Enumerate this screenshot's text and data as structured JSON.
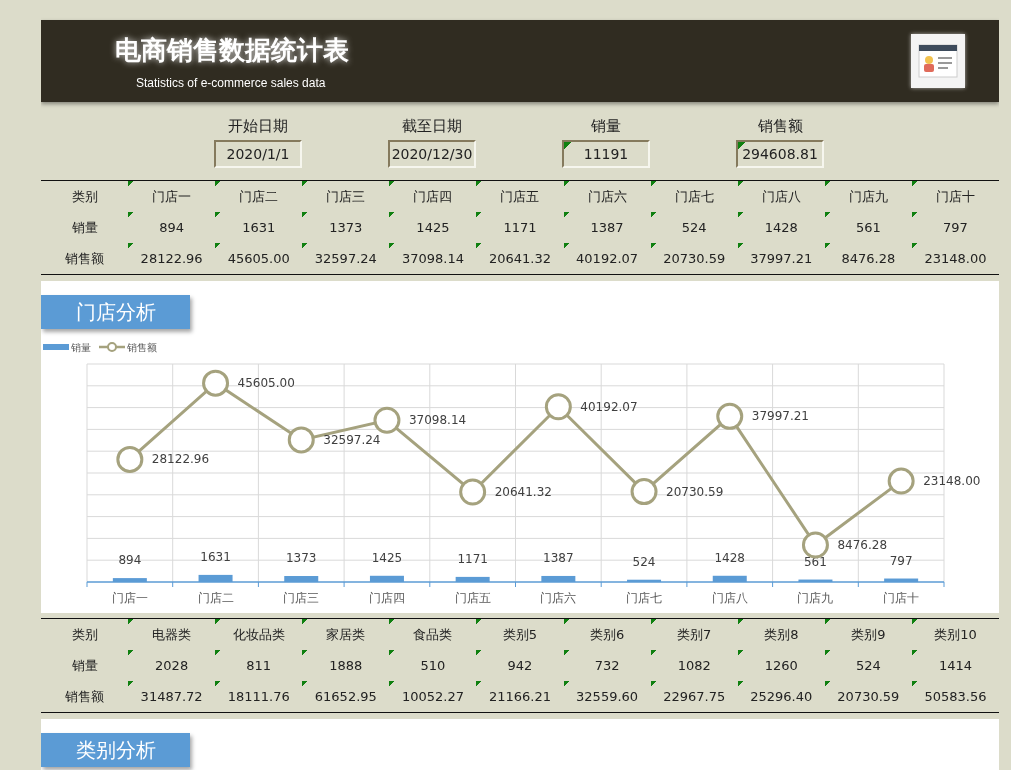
{
  "header": {
    "title": "电商销售数据统计表",
    "subtitle": "Statistics of e-commerce sales data"
  },
  "summary": [
    {
      "label": "开始日期",
      "value": "2020/1/1",
      "error_mark": false
    },
    {
      "label": "截至日期",
      "value": "2020/12/30",
      "error_mark": false
    },
    {
      "label": "销量",
      "value": "11191",
      "error_mark": true
    },
    {
      "label": "销售额",
      "value": "294608.81",
      "error_mark": true
    }
  ],
  "store_table": {
    "rows": [
      {
        "header": "类别",
        "cells": [
          "门店一",
          "门店二",
          "门店三",
          "门店四",
          "门店五",
          "门店六",
          "门店七",
          "门店八",
          "门店九",
          "门店十"
        ]
      },
      {
        "header": "销量",
        "cells": [
          "894",
          "1631",
          "1373",
          "1425",
          "1171",
          "1387",
          "524",
          "1428",
          "561",
          "797"
        ]
      },
      {
        "header": "销售额",
        "cells": [
          "28122.96",
          "45605.00",
          "32597.24",
          "37098.14",
          "20641.32",
          "40192.07",
          "20730.59",
          "37997.21",
          "8476.28",
          "23148.00"
        ]
      }
    ]
  },
  "store_section": {
    "title": "门店分析",
    "chart_data": {
      "type": "bar",
      "categories": [
        "门店一",
        "门店二",
        "门店三",
        "门店四",
        "门店五",
        "门店六",
        "门店七",
        "门店八",
        "门店九",
        "门店十"
      ],
      "ylim": [
        0,
        50000
      ],
      "data_labels": true,
      "legend": "top-left",
      "series": [
        {
          "name": "销量",
          "color": "#5b9bd5",
          "values": [
            894,
            1631,
            1373,
            1425,
            1171,
            1387,
            524,
            1428,
            561,
            797
          ],
          "value_labels": [
            "894",
            "1631",
            "1373",
            "1425",
            "1171",
            "1387",
            "524",
            "1428",
            "561",
            "797"
          ]
        },
        {
          "name": "销售额",
          "type": "line",
          "marker": "circle",
          "color": "#a5a27e",
          "values": [
            28122.96,
            45605.0,
            32597.24,
            37098.14,
            20641.32,
            40192.07,
            20730.59,
            37997.21,
            8476.28,
            23148.0
          ],
          "value_labels": [
            "28122.96",
            "45605.00",
            "32597.24",
            "37098.14",
            "20641.32",
            "40192.07",
            "20730.59",
            "37997.21",
            "8476.28",
            "23148.00"
          ]
        }
      ]
    }
  },
  "category_table": {
    "rows": [
      {
        "header": "类别",
        "cells": [
          "电器类",
          "化妆品类",
          "家居类",
          "食品类",
          "类别5",
          "类别6",
          "类别7",
          "类别8",
          "类别9",
          "类别10"
        ]
      },
      {
        "header": "销量",
        "cells": [
          "2028",
          "811",
          "1888",
          "510",
          "942",
          "732",
          "1082",
          "1260",
          "524",
          "1414"
        ]
      },
      {
        "header": "销售额",
        "cells": [
          "31487.72",
          "18111.76",
          "61652.95",
          "10052.27",
          "21166.21",
          "32559.60",
          "22967.75",
          "25296.40",
          "20730.59",
          "50583.56"
        ]
      }
    ]
  },
  "category_section": {
    "title": "类别分析"
  }
}
